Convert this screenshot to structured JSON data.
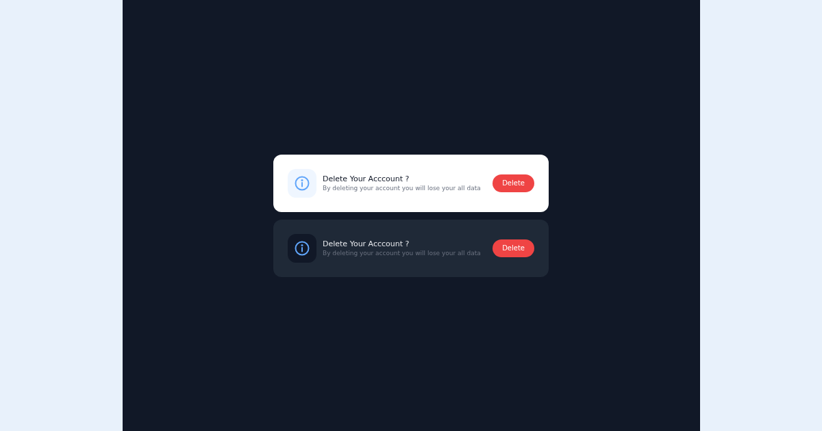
{
  "cards": [
    {
      "kind": "light",
      "title": "Delete Your Acccount ?",
      "message": "By deleting your account you will lose your all data",
      "button": "Delete"
    },
    {
      "kind": "dark",
      "title": "Delete Your Acccount ?",
      "message": "By deleting your account you will lose your all data",
      "button": "Delete"
    }
  ]
}
